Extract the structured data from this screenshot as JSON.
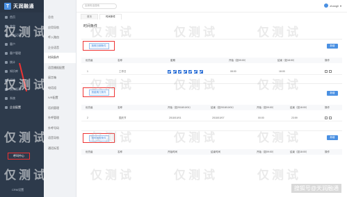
{
  "brand": {
    "logo": "T",
    "name": "天润融通"
  },
  "sidebar": {
    "items": [
      "首页",
      "来电",
      "业务记录",
      "客户",
      "客户管理",
      "统计",
      "知识库",
      "运维",
      "统计报表",
      "系统",
      "企业配置"
    ],
    "callcenter": "呼叫中心",
    "crm": "CRM设置"
  },
  "subnav": {
    "items": [
      "总览",
      "应用导航",
      "呼入路由",
      "企业语音",
      "时间条件",
      "语音播报配置",
      "留言箱",
      "电话组",
      "IVR配置",
      "话机管理",
      "外呼管理",
      "外呼号码",
      "语音导航",
      "通话标签"
    ],
    "active_index": 4
  },
  "topbar": {
    "search_placeholder": "坐席电话搜索",
    "user": "zhangli"
  },
  "tabs": [
    "首页",
    "时间条件"
  ],
  "page_title": "时间条件",
  "panel1": {
    "tag": "按照日期条件",
    "add": "新增",
    "headers": [
      "优先级",
      "名称",
      "星期",
      "开始（如09:00）",
      "结束（如18:00）",
      "操作"
    ],
    "row": {
      "priority": "1",
      "name": "工作日",
      "weekdays_checked": 7,
      "start": "08:00",
      "end": "18:00"
    }
  },
  "panel2": {
    "tag": "按星期几条件",
    "add": "新增",
    "headers": [
      "优先级",
      "名称",
      "开始（如2018/10/01）",
      "结束（如2018/10/01）",
      "开始（如09:00）",
      "结束（如18:00）",
      "操作"
    ],
    "row": {
      "priority": "2",
      "name": "国庆节",
      "start_date": "2018/10/01",
      "end_date": "2018/10/07",
      "start": "00:00",
      "end": "23:59"
    }
  },
  "panel3": {
    "tag": "按时间段条件",
    "add": "新增",
    "headers": [
      "优先级",
      "名称",
      "开始时间",
      "结束时间",
      "开始（如09:00）",
      "结束（如18:00）",
      "操作"
    ]
  },
  "watermark": "仅测试",
  "footer_watermark": "搜狐号@天润融通"
}
